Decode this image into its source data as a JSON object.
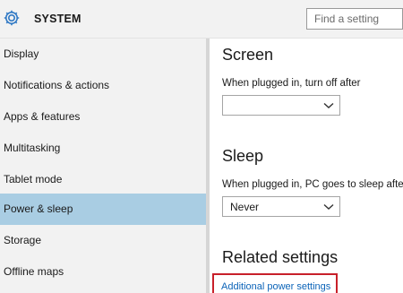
{
  "header": {
    "title": "SYSTEM",
    "search": {
      "value": "",
      "placeholder": "Find a setting"
    }
  },
  "sidebar": {
    "items": [
      {
        "label": "Display"
      },
      {
        "label": "Notifications & actions"
      },
      {
        "label": "Apps & features"
      },
      {
        "label": "Multitasking"
      },
      {
        "label": "Tablet mode"
      },
      {
        "label": "Power & sleep",
        "selected": true
      },
      {
        "label": "Storage"
      },
      {
        "label": "Offline maps"
      }
    ]
  },
  "main": {
    "screen": {
      "title": "Screen",
      "label": "When plugged in, turn off after",
      "selected_value": ""
    },
    "sleep": {
      "title": "Sleep",
      "label": "When plugged in, PC goes to sleep after",
      "selected_value": "Never"
    },
    "related": {
      "title": "Related settings",
      "link": "Additional power settings"
    }
  },
  "colors": {
    "selected_nav": "#a9cde3",
    "accent": "#0b63b8",
    "highlight_box": "#c8202a"
  },
  "icons": {
    "app": "gear-icon",
    "dropdown": "chevron-down-icon"
  }
}
